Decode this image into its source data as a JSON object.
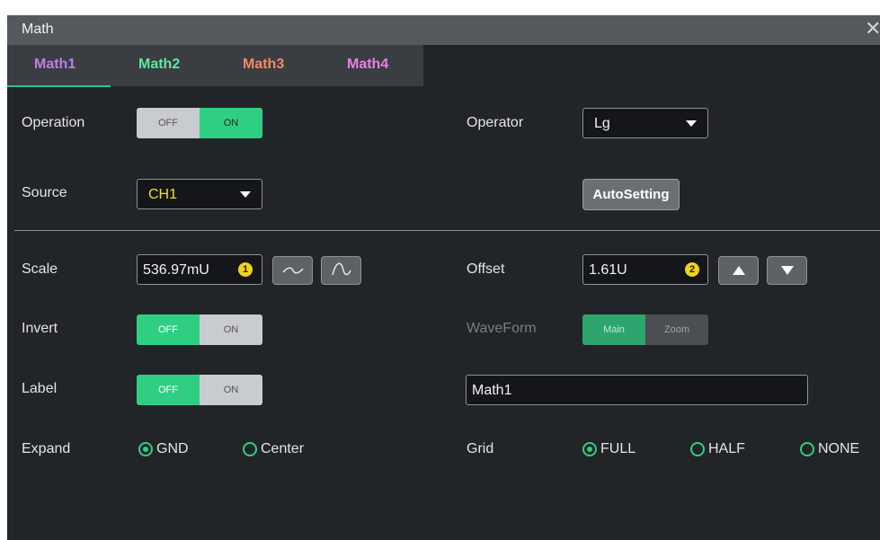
{
  "window": {
    "title": "Math",
    "close_glyph": "✕"
  },
  "tabs": [
    {
      "label": "Math1",
      "color": "#c07fe0",
      "active": true
    },
    {
      "label": "Math2",
      "color": "#5fe6a0"
    },
    {
      "label": "Math3",
      "color": "#f2896a"
    },
    {
      "label": "Math4",
      "color": "#e681e6"
    }
  ],
  "operation": {
    "label": "Operation",
    "off": "OFF",
    "on": "ON",
    "value": "ON"
  },
  "operator": {
    "label": "Operator",
    "value": "Lg"
  },
  "source": {
    "label": "Source",
    "value": "CH1",
    "value_color": "#f2e11c"
  },
  "autosetting": {
    "label": "AutoSetting"
  },
  "scale": {
    "label": "Scale",
    "value": "536.97mU",
    "badge": "1"
  },
  "offset": {
    "label": "Offset",
    "value": "1.61U",
    "badge": "2"
  },
  "invert": {
    "label": "Invert",
    "off": "OFF",
    "on": "ON",
    "value": "OFF"
  },
  "waveform": {
    "label": "WaveForm",
    "main": "Main",
    "zoom": "Zoom",
    "value": "Main"
  },
  "label_row": {
    "label": "Label",
    "off": "OFF",
    "on": "ON",
    "value": "OFF",
    "text": "Math1"
  },
  "expand": {
    "label": "Expand",
    "options": [
      "GND",
      "Center"
    ],
    "selected": "GND"
  },
  "grid": {
    "label": "Grid",
    "options": [
      "FULL",
      "HALF",
      "NONE"
    ],
    "selected": "FULL"
  },
  "colors": {
    "accent": "#2fcf83",
    "panel_bg": "#222528"
  }
}
